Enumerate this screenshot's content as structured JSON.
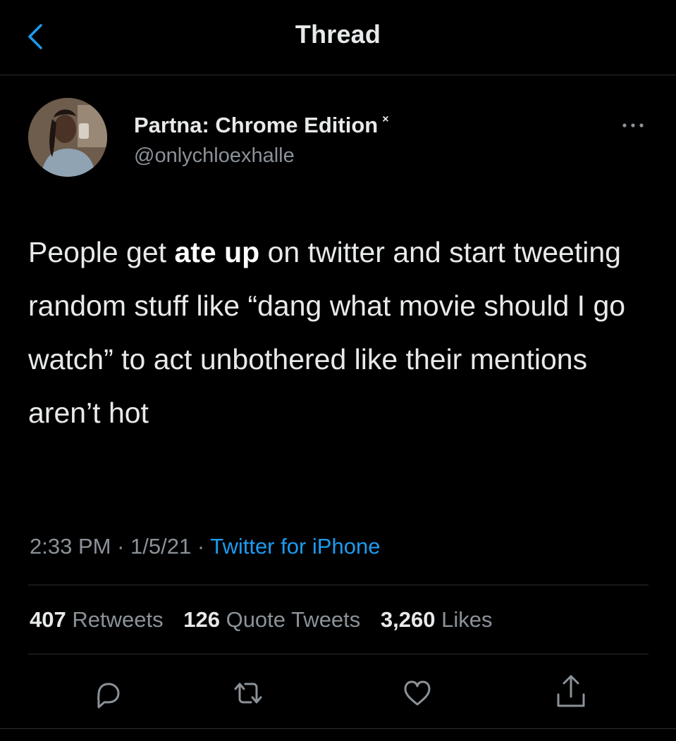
{
  "header": {
    "title": "Thread",
    "back_icon": "chevron-left-icon"
  },
  "tweet": {
    "author": {
      "display_name": "Partna: Chrome Edition",
      "name_mark": "×",
      "handle": "@onlychloexhalle"
    },
    "text": {
      "before": "People get ",
      "bold": "ate up",
      "after": " on twitter and start tweeting random stuff like “dang what movie should I go watch” to act unbothered like their mentions aren’t hot"
    },
    "time": "2:33 PM",
    "date": "1/5/21",
    "separator": " · ",
    "source": "Twitter for iPhone",
    "stats": {
      "retweets_count": "407",
      "retweets_label": "Retweets",
      "quotes_count": "126",
      "quotes_label": "Quote Tweets",
      "likes_count": "3,260",
      "likes_label": "Likes"
    }
  },
  "actions": [
    "reply-icon",
    "retweet-icon",
    "like-icon",
    "share-icon"
  ],
  "colors": {
    "background": "#000000",
    "text": "#e7e9ea",
    "secondary_text": "#8b9299",
    "accent": "#1d9bf0",
    "divider": "#2a2d30"
  }
}
